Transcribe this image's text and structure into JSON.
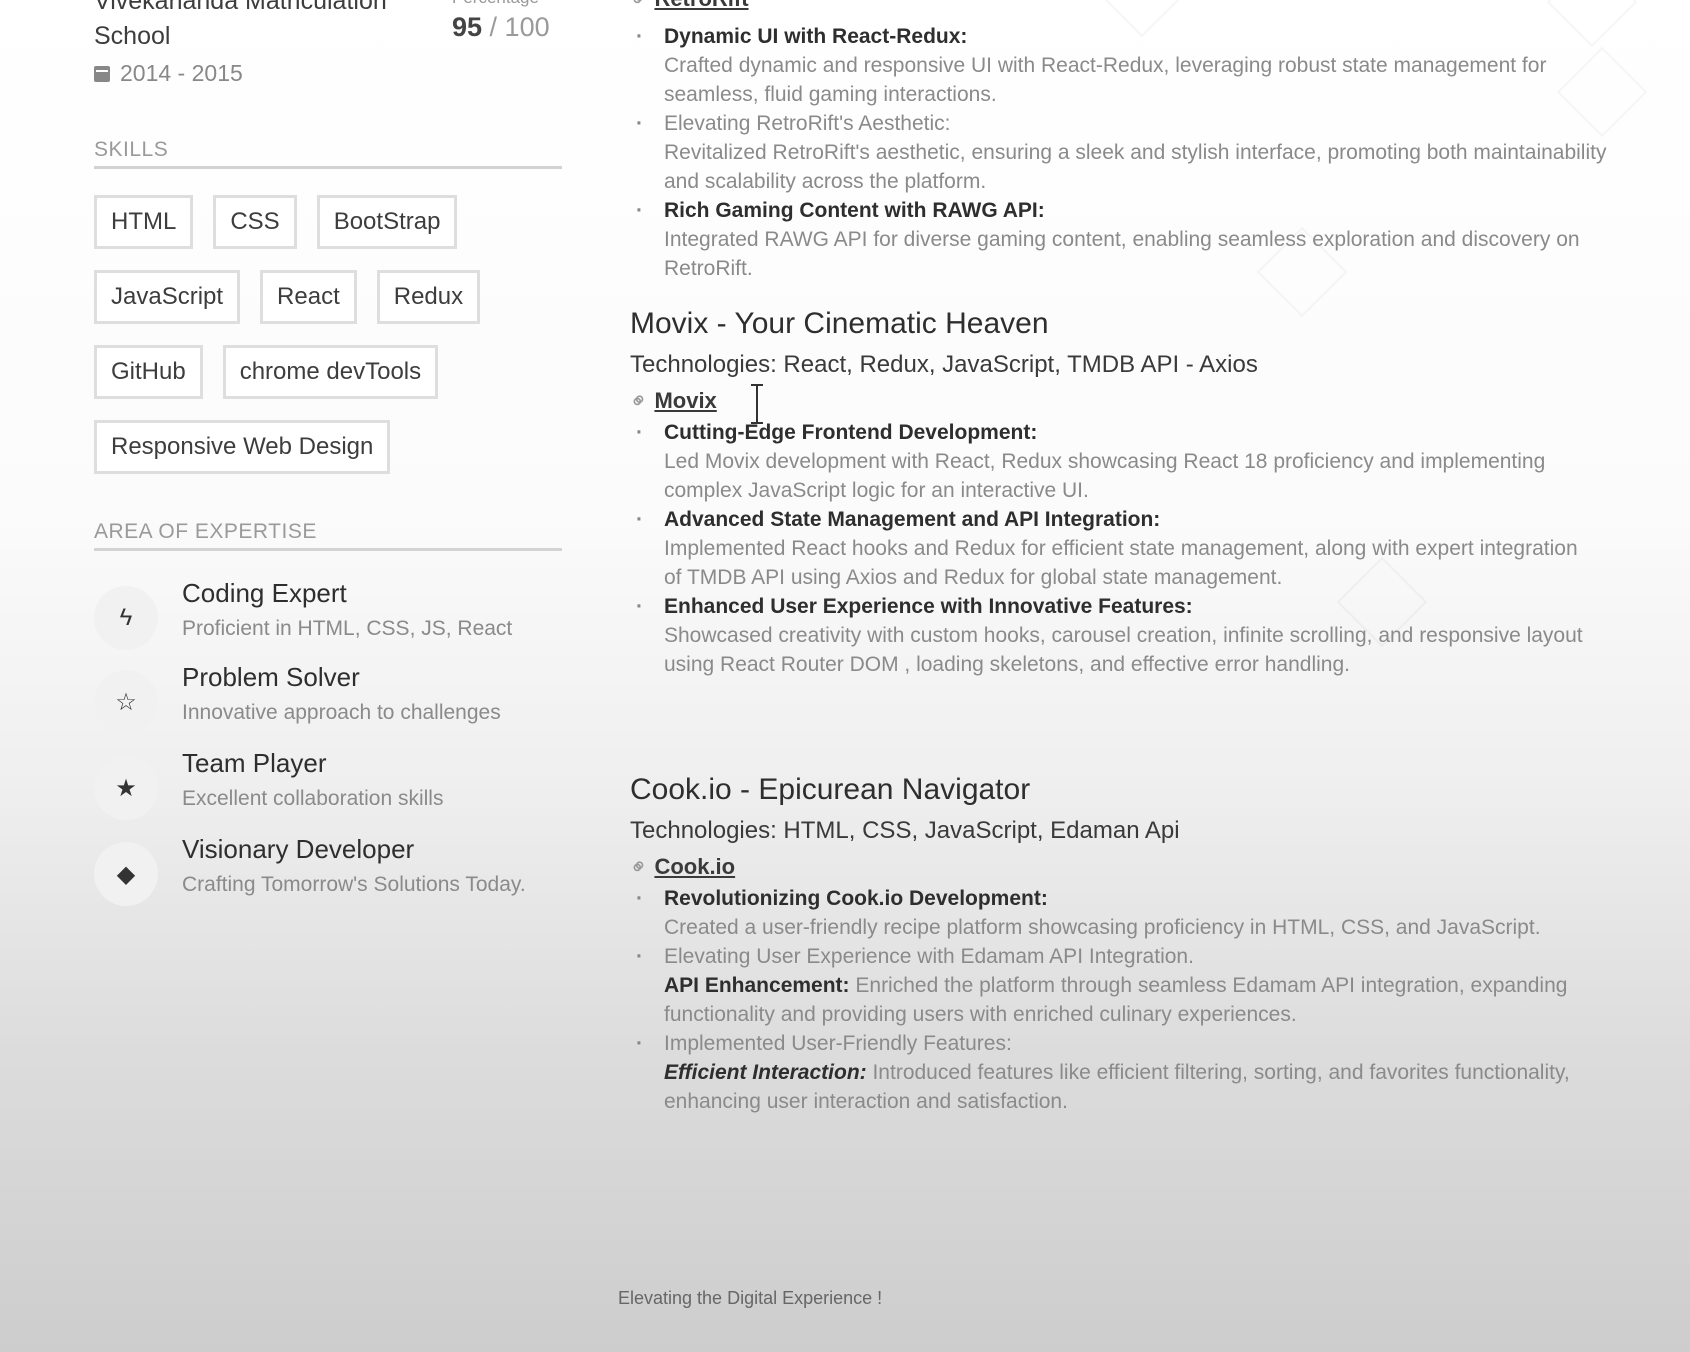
{
  "education": {
    "school": "Vivekananda Matriculation School",
    "years": "2014 - 2015",
    "score_label": "Percentage",
    "score_value": "95",
    "score_total": " / 100"
  },
  "skills": {
    "heading": "SKILLS",
    "rows": [
      [
        "HTML",
        "CSS",
        "BootStrap"
      ],
      [
        "JavaScript",
        "React",
        "Redux"
      ],
      [
        "GitHub",
        "chrome devTools"
      ],
      [
        "Responsive Web Design"
      ]
    ]
  },
  "expertise": {
    "heading": "AREA OF EXPERTISE",
    "items": [
      {
        "icon": "lightning-icon",
        "glyph": "ϟ",
        "title": "Coding Expert",
        "desc": "Proficient in HTML, CSS, JS, React"
      },
      {
        "icon": "star-outline-icon",
        "glyph": "☆",
        "title": "Problem Solver",
        "desc": "Innovative approach to challenges"
      },
      {
        "icon": "star-half-icon",
        "glyph": "★",
        "title": "Team Player",
        "desc": "Excellent collaboration skills"
      },
      {
        "icon": "diamond-icon",
        "glyph": "◆",
        "title": "Visionary Developer",
        "desc": "Crafting Tomorrow's Solutions Today."
      }
    ]
  },
  "retrorift": {
    "link": "RetroRift",
    "bullets": [
      {
        "title": "Dynamic UI with React-Redux:",
        "text": "Crafted dynamic and responsive UI with React-Redux, leveraging robust state management for seamless, fluid gaming interactions."
      },
      {
        "title": "Elevating RetroRift's Aesthetic:",
        "text": "Revitalized RetroRift's aesthetic, ensuring a sleek and stylish interface, promoting both maintainability and scalability across the platform.",
        "title_normal": true
      },
      {
        "title": "Rich Gaming Content with RAWG API:",
        "text": "Integrated RAWG API for diverse gaming content, enabling seamless exploration and discovery on RetroRift."
      }
    ]
  },
  "movix": {
    "title": "Movix - Your Cinematic Heaven",
    "tech": "Technologies: React, Redux, JavaScript, TMDB API - Axios",
    "link": "Movix",
    "bullets": [
      {
        "title": "Cutting-Edge Frontend Development:",
        "text": "Led Movix development with React, Redux showcasing React 18 proficiency and implementing complex JavaScript logic for an interactive UI."
      },
      {
        "title": "Advanced State Management and API Integration:",
        "text": "Implemented React hooks and Redux for efficient state management, along with expert integration of TMDB API using Axios and Redux  for global state management."
      },
      {
        "title": "Enhanced User Experience with Innovative Features:",
        "text": "Showcased creativity with custom hooks, carousel creation, infinite scrolling, and responsive layout using React Router DOM , loading skeletons, and effective error handling."
      }
    ]
  },
  "cookio": {
    "title": "Cook.io - Epicurean Navigator",
    "tech": "Technologies: HTML, CSS, JavaScript, Edaman Api",
    "link": "Cook.io",
    "b1_title": "Revolutionizing Cook.io Development:",
    "b1_text": "Created a user-friendly recipe platform showcasing proficiency in HTML, CSS, and JavaScript.",
    "b2_title": "Elevating User Experience with Edamam API Integration.",
    "b2_lead": "API Enhancement:",
    "b2_text": " Enriched the platform through seamless Edamam API integration, expanding functionality and providing users with enriched culinary experiences.",
    "b3_title": "Implemented User-Friendly Features:",
    "b3_lead": "Efficient Interaction:",
    "b3_text": " Introduced features like efficient filtering, sorting, and favorites functionality, enhancing user interaction and satisfaction."
  },
  "footer": "Elevating the Digital Experience !"
}
